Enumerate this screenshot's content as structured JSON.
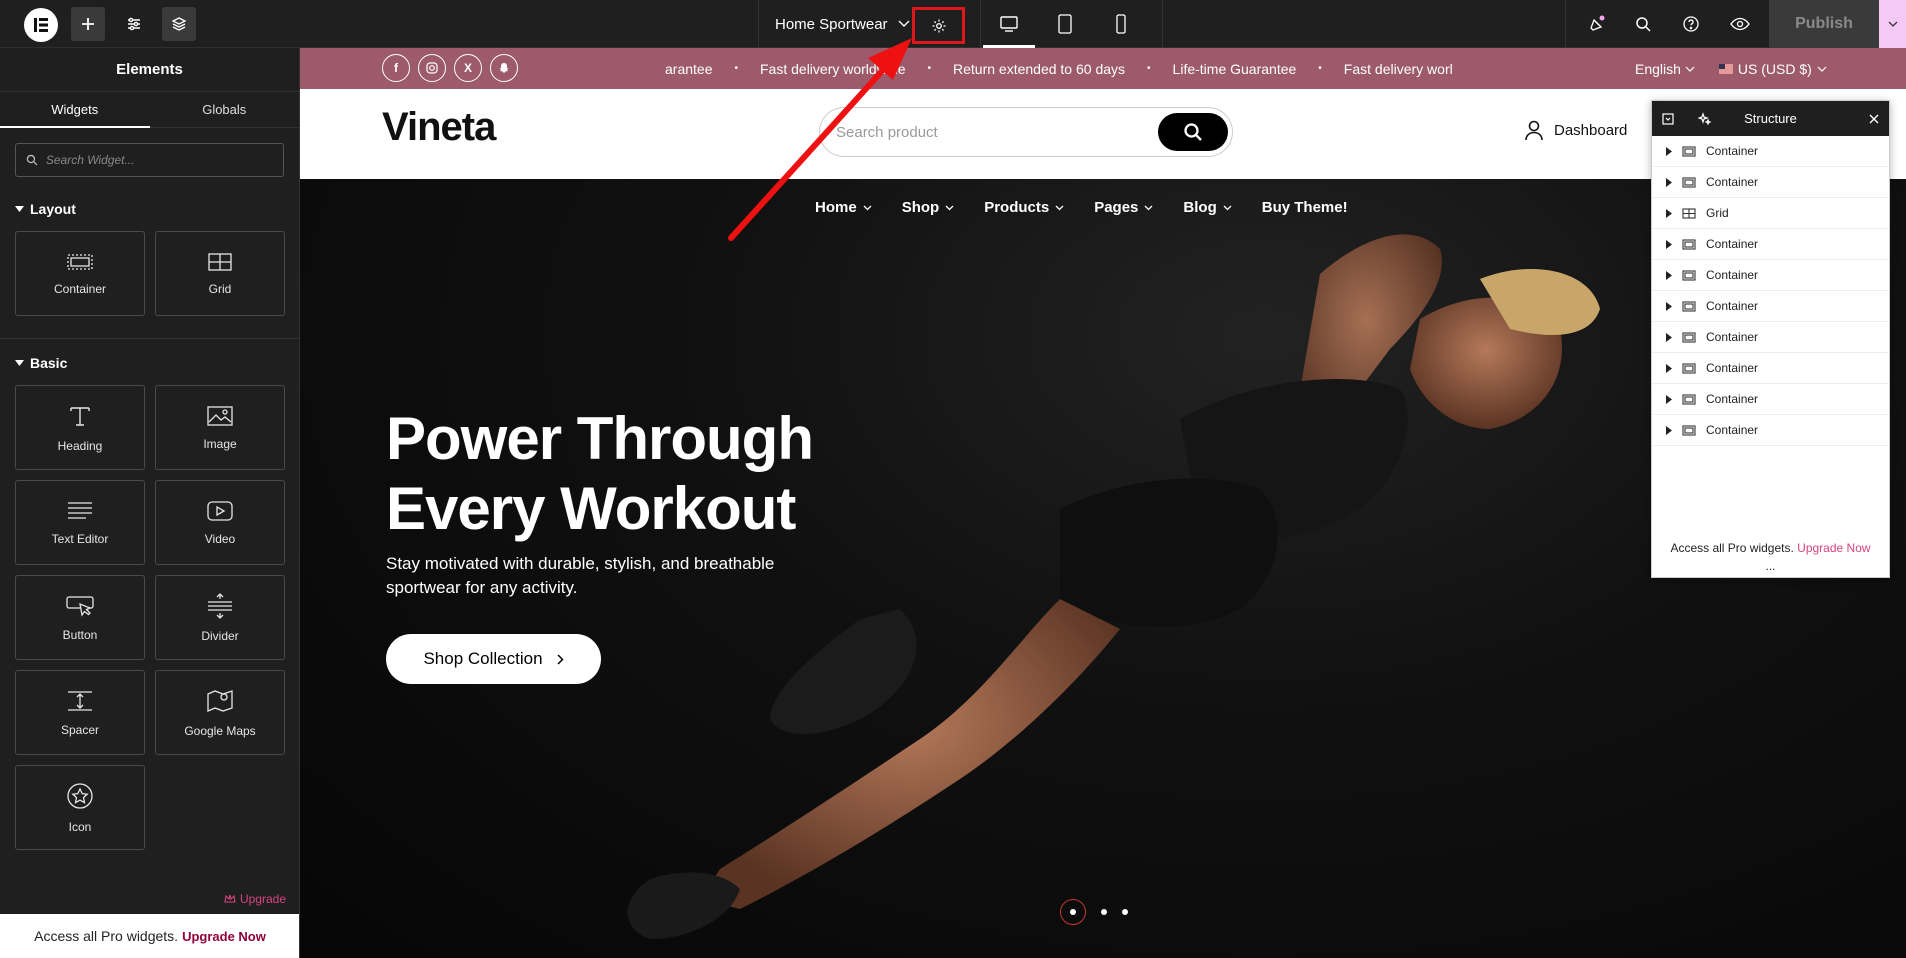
{
  "topbar": {
    "document_title": "Home Sportwear",
    "publish_label": "Publish",
    "accent_highlight": "#e0171a"
  },
  "panel": {
    "title": "Elements",
    "tabs": [
      "Widgets",
      "Globals"
    ],
    "search_placeholder": "Search Widget...",
    "sections": [
      {
        "label": "Layout",
        "widgets": [
          {
            "label": "Container",
            "icon": "container-icon"
          },
          {
            "label": "Grid",
            "icon": "grid-icon"
          }
        ]
      },
      {
        "label": "Basic",
        "widgets": [
          {
            "label": "Heading",
            "icon": "heading-icon"
          },
          {
            "label": "Image",
            "icon": "image-icon"
          },
          {
            "label": "Text Editor",
            "icon": "text-editor-icon"
          },
          {
            "label": "Video",
            "icon": "video-icon"
          },
          {
            "label": "Button",
            "icon": "button-icon"
          },
          {
            "label": "Divider",
            "icon": "divider-icon"
          },
          {
            "label": "Spacer",
            "icon": "spacer-icon"
          },
          {
            "label": "Google Maps",
            "icon": "map-icon"
          },
          {
            "label": "Icon",
            "icon": "star-icon"
          }
        ]
      }
    ],
    "upgrade_label": "Upgrade",
    "pro_text": "Access all Pro widgets.",
    "pro_link": "Upgrade Now"
  },
  "site": {
    "marquee": [
      "arantee",
      "Fast delivery worldwide",
      "Return extended to 60 days",
      "Life-time Guarantee",
      "Fast delivery worl"
    ],
    "language": "English",
    "currency": "US (USD $)",
    "brand": "Vineta",
    "search_placeholder": "Search product",
    "dashboard_label": "Dashboard",
    "nav": [
      "Home",
      "Shop",
      "Products",
      "Pages",
      "Blog",
      "Buy Theme!"
    ],
    "hero_title_line1": "Power Through",
    "hero_title_line2": "Every Workout",
    "hero_subtitle": "Stay motivated with durable, stylish, and breathable sportwear for any activity.",
    "hero_button": "Shop Collection",
    "promo_color": "#9c5a6a"
  },
  "structure": {
    "title": "Structure",
    "items": [
      "Container",
      "Container",
      "Grid",
      "Container",
      "Container",
      "Container",
      "Container",
      "Container",
      "Container",
      "Container"
    ],
    "footer_text": "Access all Pro widgets.",
    "footer_link": "Upgrade Now",
    "grip": "..."
  }
}
